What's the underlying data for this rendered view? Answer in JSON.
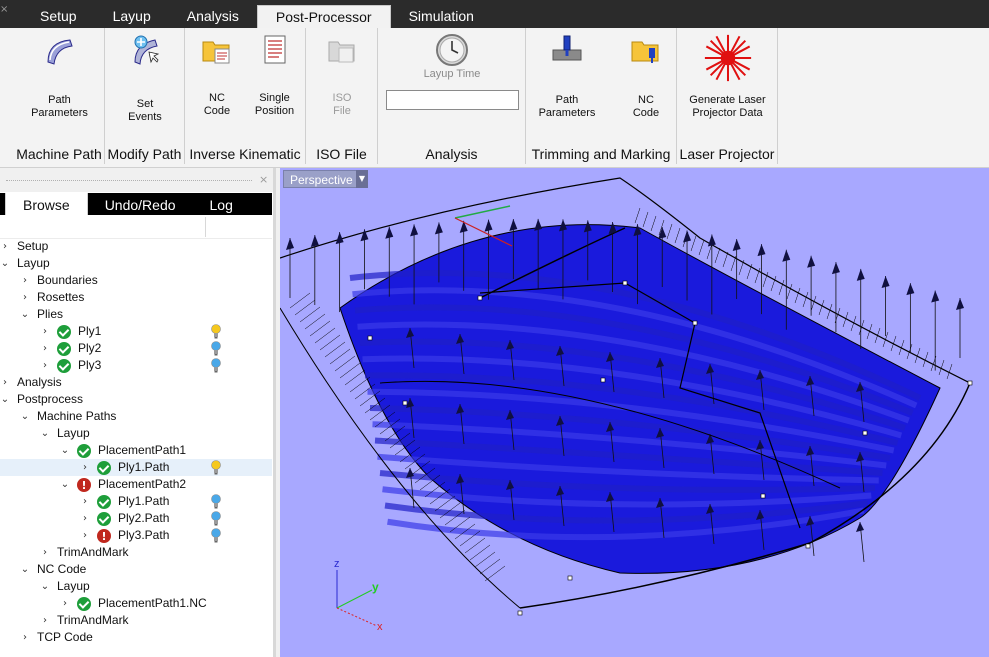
{
  "tabs": [
    "Setup",
    "Layup",
    "Analysis",
    "Post-Processor",
    "Simulation"
  ],
  "active_tab": "Post-Processor",
  "ribbon": {
    "groups": [
      {
        "label": "Machine Path",
        "buttons": [
          {
            "label": "Path\nParameters",
            "icon": "path-parameters-icon"
          }
        ]
      },
      {
        "label": "Modify Path",
        "buttons": [
          {
            "label": "Set\nEvents",
            "icon": "set-events-icon"
          }
        ]
      },
      {
        "label": "Inverse Kinematic",
        "buttons": [
          {
            "label": "NC\nCode",
            "icon": "folder-nc-icon"
          },
          {
            "label": "Single\nPosition",
            "icon": "single-position-icon"
          }
        ]
      },
      {
        "label": "ISO File",
        "buttons": [
          {
            "label": "ISO\nFile",
            "icon": "iso-file-icon",
            "disabled": true
          }
        ]
      },
      {
        "label": "Analysis",
        "buttons": [
          {
            "label": "Layup Time",
            "icon": "clock-icon"
          }
        ],
        "field_value": ""
      },
      {
        "label": "Trimming and Marking",
        "buttons": [
          {
            "label": "Path\nParameters",
            "icon": "trim-path-icon"
          },
          {
            "label": "NC\nCode",
            "icon": "folder-nc-icon"
          }
        ]
      },
      {
        "label": "Laser Projector",
        "buttons": [
          {
            "label": "Generate Laser\nProjector Data",
            "icon": "laser-icon"
          }
        ]
      }
    ]
  },
  "panel": {
    "tabs": [
      "Browse",
      "Undo/Redo",
      "Log"
    ],
    "active_tab": "Browse"
  },
  "tree": [
    {
      "label": "Setup",
      "level": 0,
      "chevron": "›"
    },
    {
      "label": "Layup",
      "level": 0,
      "chevron": "⌄"
    },
    {
      "label": "Boundaries",
      "level": 1,
      "chevron": "›"
    },
    {
      "label": "Rosettes",
      "level": 1,
      "chevron": "›"
    },
    {
      "label": "Plies",
      "level": 1,
      "chevron": "⌄"
    },
    {
      "label": "Ply1",
      "level": 2,
      "chevron": "›",
      "status": "ok",
      "bulb": "yellow"
    },
    {
      "label": "Ply2",
      "level": 2,
      "chevron": "›",
      "status": "ok",
      "bulb": "blue"
    },
    {
      "label": "Ply3",
      "level": 2,
      "chevron": "›",
      "status": "ok",
      "bulb": "blue"
    },
    {
      "label": "Analysis",
      "level": 0,
      "chevron": "›"
    },
    {
      "label": "Postprocess",
      "level": 0,
      "chevron": "⌄"
    },
    {
      "label": "Machine Paths",
      "level": 1,
      "chevron": "⌄"
    },
    {
      "label": "Layup",
      "level": 2,
      "chevron": "⌄"
    },
    {
      "label": "PlacementPath1",
      "level": 3,
      "chevron": "⌄",
      "status": "ok"
    },
    {
      "label": "Ply1.Path",
      "level": 4,
      "chevron": "›",
      "status": "ok",
      "bulb": "yellow",
      "selected": true
    },
    {
      "label": "PlacementPath2",
      "level": 3,
      "chevron": "⌄",
      "status": "err"
    },
    {
      "label": "Ply1.Path",
      "level": 4,
      "chevron": "›",
      "status": "ok",
      "bulb": "blue"
    },
    {
      "label": "Ply2.Path",
      "level": 4,
      "chevron": "›",
      "status": "ok",
      "bulb": "blue"
    },
    {
      "label": "Ply3.Path",
      "level": 4,
      "chevron": "›",
      "status": "err",
      "bulb": "blue"
    },
    {
      "label": "TrimAndMark",
      "level": 2,
      "chevron": "›"
    },
    {
      "label": "NC Code",
      "level": 1,
      "chevron": "⌄"
    },
    {
      "label": "Layup",
      "level": 2,
      "chevron": "⌄"
    },
    {
      "label": "PlacementPath1.NC",
      "level": 3,
      "chevron": "›",
      "status": "ok"
    },
    {
      "label": "TrimAndMark",
      "level": 2,
      "chevron": "›"
    },
    {
      "label": "TCP Code",
      "level": 1,
      "chevron": "›"
    }
  ],
  "viewport": {
    "view_label": "Perspective",
    "background_color": "#a8a8ff",
    "surface_color": "#1a1adc",
    "axes": {
      "x": "x",
      "y": "y",
      "z": "z"
    }
  },
  "colors": {
    "topbar": "#2b2b2b",
    "status_ok": "#1e9e3a",
    "status_err": "#c0281e",
    "bulb_yellow": "#f5c81e",
    "bulb_blue": "#4aa8e8"
  }
}
